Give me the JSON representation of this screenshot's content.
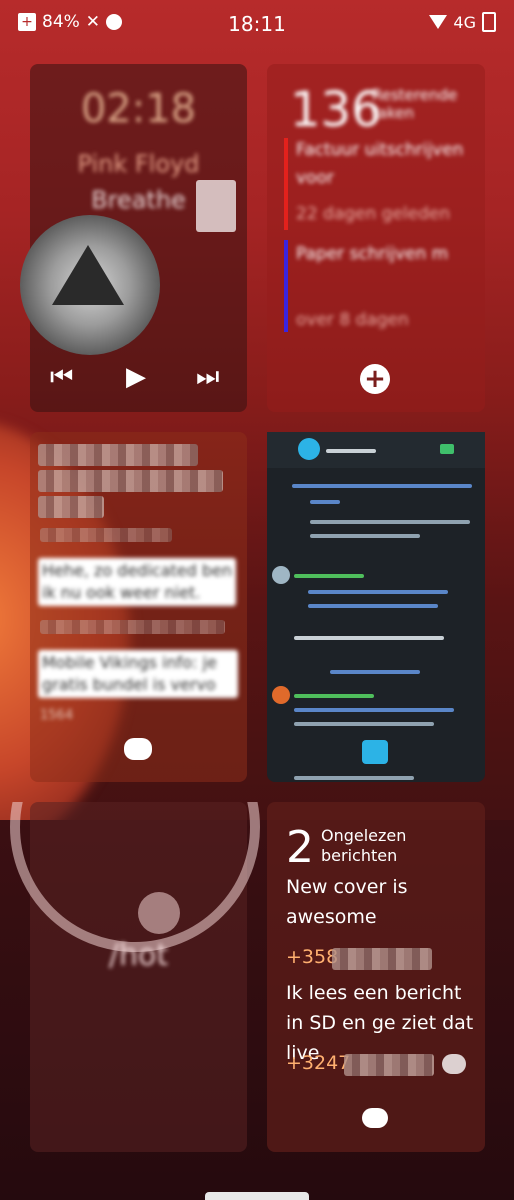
{
  "statusbar": {
    "battery_left": "84%",
    "time": "18:11",
    "network": "4G"
  },
  "music": {
    "clock": "02:18",
    "artist": "Pink Floyd",
    "song": "Breathe"
  },
  "tasks": {
    "count": "136",
    "label": "Resterende taken",
    "items": [
      {
        "title": "Factuur uitschrijven",
        "title_cont": "voor",
        "due": "22 dagen geleden",
        "color": "#e3211c"
      },
      {
        "title": "Paper schrijven m",
        "title_cont": "",
        "due": "over 8 dagen",
        "color": "#3a24e0"
      }
    ]
  },
  "sms": {
    "bubbles": [
      "Hehe, zo dedicated ben ik nu ook weer niet.",
      "Mobile Vikings info: je gratis bundel is vervo"
    ],
    "last_meta": "1564"
  },
  "hot": {
    "label": "/hot"
  },
  "messages": {
    "count": "2",
    "label": "Ongelezen berichten",
    "first_text": "New cover is awesome",
    "first_number": "+358",
    "second_text": "Ik lees een bericht in SD en ge ziet dat live",
    "second_number": "+3247"
  }
}
